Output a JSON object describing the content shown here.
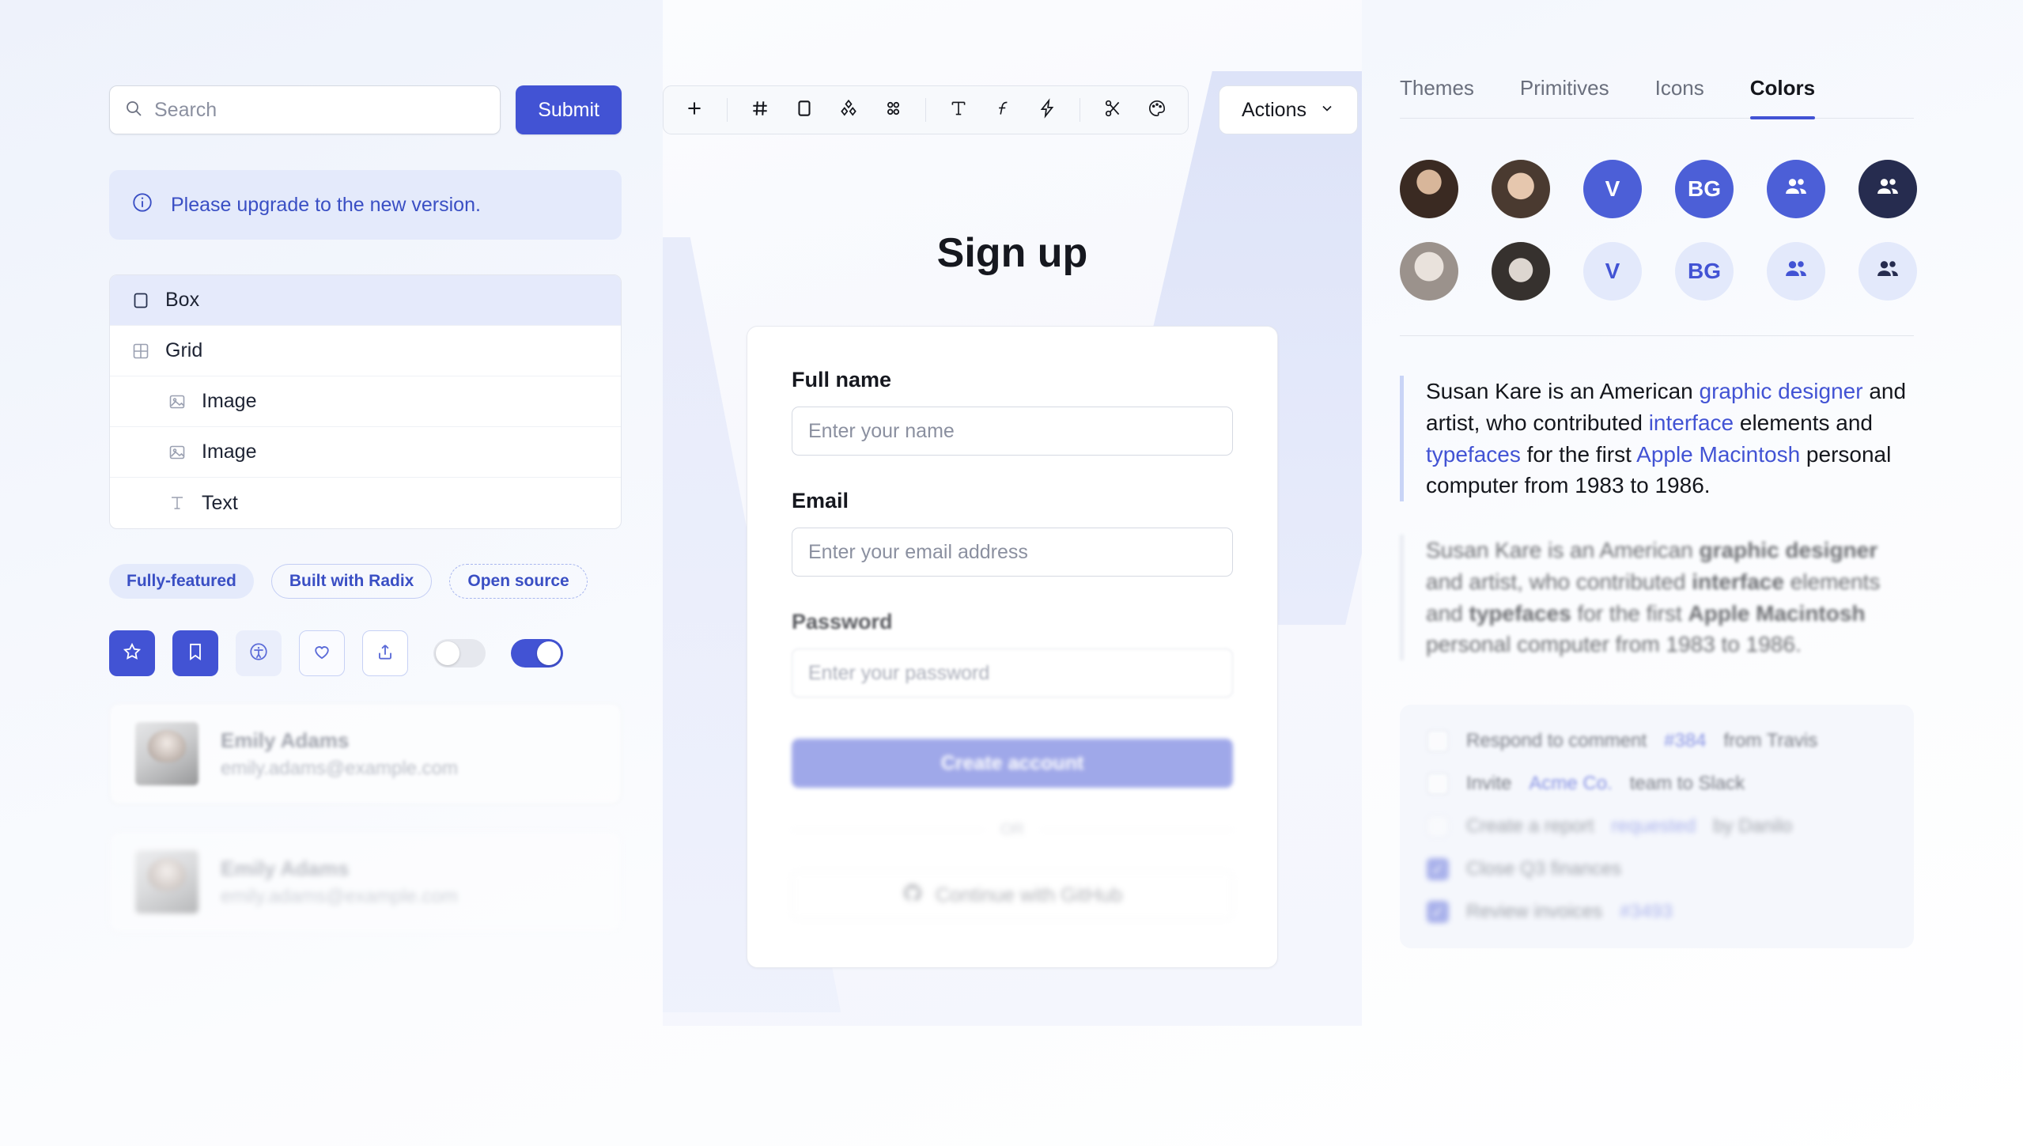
{
  "left": {
    "search": {
      "placeholder": "Search",
      "icon": "search-icon"
    },
    "submit_label": "Submit",
    "callout": {
      "icon": "info-circle-icon",
      "text": "Please upgrade to the new version."
    },
    "tree": [
      {
        "label": "Box",
        "icon": "square-icon",
        "selected": true,
        "indent": false
      },
      {
        "label": "Grid",
        "icon": "grid-icon",
        "selected": false,
        "indent": false
      },
      {
        "label": "Image",
        "icon": "image-icon",
        "selected": false,
        "indent": true
      },
      {
        "label": "Image",
        "icon": "image-icon",
        "selected": false,
        "indent": true
      },
      {
        "label": "Text",
        "icon": "text-t-icon",
        "selected": false,
        "indent": true
      }
    ],
    "badges": [
      {
        "label": "Fully-featured",
        "style": "soft"
      },
      {
        "label": "Built with Radix",
        "style": "outline"
      },
      {
        "label": "Open source",
        "style": "dashed"
      }
    ],
    "icon_buttons": [
      {
        "icon": "star-icon",
        "style": "solid"
      },
      {
        "icon": "bookmark-icon",
        "style": "solid"
      },
      {
        "icon": "accessibility-icon",
        "style": "soft"
      },
      {
        "icon": "heart-icon",
        "style": "outline"
      },
      {
        "icon": "share-icon",
        "style": "outline2"
      }
    ],
    "switches": [
      {
        "state": "off"
      },
      {
        "state": "on"
      }
    ],
    "users": [
      {
        "name": "Emily Adams",
        "email": "emily.adams@example.com"
      },
      {
        "name": "Emily Adams",
        "email": "emily.adams@example.com"
      }
    ]
  },
  "toolbar": {
    "tools": [
      {
        "icon": "plus-icon"
      },
      {
        "icon": "divider"
      },
      {
        "icon": "hash-grid-icon"
      },
      {
        "icon": "square-outline-icon"
      },
      {
        "icon": "diamonds-icon"
      },
      {
        "icon": "dots-grid-icon"
      },
      {
        "icon": "divider"
      },
      {
        "icon": "text-t-icon"
      },
      {
        "icon": "font-f-icon"
      },
      {
        "icon": "lightning-icon"
      },
      {
        "icon": "divider"
      },
      {
        "icon": "scissors-icon"
      },
      {
        "icon": "palette-icon"
      }
    ],
    "actions_label": "Actions",
    "actions_caret": "chevron-down-icon"
  },
  "center": {
    "title": "Sign up",
    "fields": [
      {
        "label": "Full name",
        "placeholder": "Enter your name"
      },
      {
        "label": "Email",
        "placeholder": "Enter your email address"
      },
      {
        "label": "Password",
        "placeholder": "Enter your password"
      }
    ],
    "create_label": "Create account",
    "or_label": "OR",
    "github_label": "Continue with GitHub",
    "github_icon": "github-icon"
  },
  "right": {
    "tabs": [
      {
        "label": "Themes",
        "active": false
      },
      {
        "label": "Primitives",
        "active": false
      },
      {
        "label": "Icons",
        "active": false
      },
      {
        "label": "Colors",
        "active": true
      }
    ],
    "avatars_row1": [
      {
        "kind": "photo",
        "variant": "photo1"
      },
      {
        "kind": "photo",
        "variant": "photo2"
      },
      {
        "kind": "initials",
        "label": "V",
        "variant": "solid"
      },
      {
        "kind": "initials",
        "label": "BG",
        "variant": "solid"
      },
      {
        "kind": "icon",
        "icon": "people-icon",
        "variant": "solid"
      },
      {
        "kind": "icon",
        "icon": "people-icon",
        "variant": "dark"
      }
    ],
    "avatars_row2": [
      {
        "kind": "photo",
        "variant": "photo3"
      },
      {
        "kind": "photo",
        "variant": "photo4"
      },
      {
        "kind": "initials",
        "label": "V",
        "variant": "softbg"
      },
      {
        "kind": "initials",
        "label": "BG",
        "variant": "softbg"
      },
      {
        "kind": "icon",
        "icon": "people-icon",
        "variant": "softbg"
      },
      {
        "kind": "icon",
        "icon": "people-icon",
        "variant": "softbg darkglyph"
      }
    ],
    "quote1": {
      "p1": "Susan Kare is an American ",
      "link1": "graphic designer",
      "p2": " and artist, who contributed ",
      "link2": "interface",
      "p3": " elements and ",
      "link3": "typefaces",
      "p4": " for the first ",
      "link4": "Apple Macintosh",
      "p5": " personal computer from 1983 to 1986."
    },
    "quote2": {
      "p1": "Susan Kare is an American ",
      "b1": "graphic designer",
      "p2": " and artist, who contributed ",
      "b2": "interface",
      "p3": " elements and ",
      "b3": "typefaces",
      "p4": " for the first ",
      "b4": "Apple Macintosh",
      "p5": " personal computer from 1983 to 1986."
    },
    "todos": [
      {
        "pre": "Respond to comment ",
        "link": "#384",
        "post": " from Travis",
        "checked": false
      },
      {
        "pre": "Invite ",
        "link": "Acme Co.",
        "post": " team to Slack",
        "checked": false
      },
      {
        "pre": "Create a report ",
        "link": "requested",
        "post": " by Danilo",
        "checked": false
      },
      {
        "pre": "Close Q3 finances",
        "link": "",
        "post": "",
        "checked": true
      },
      {
        "pre": "Review invoices ",
        "link": "#3493",
        "post": "",
        "checked": true
      }
    ]
  },
  "colors": {
    "accent": "#4253d4",
    "accent_soft": "#e4eafb",
    "dark": "#262c4f",
    "text": "#14161c",
    "muted": "#8b90a0"
  }
}
